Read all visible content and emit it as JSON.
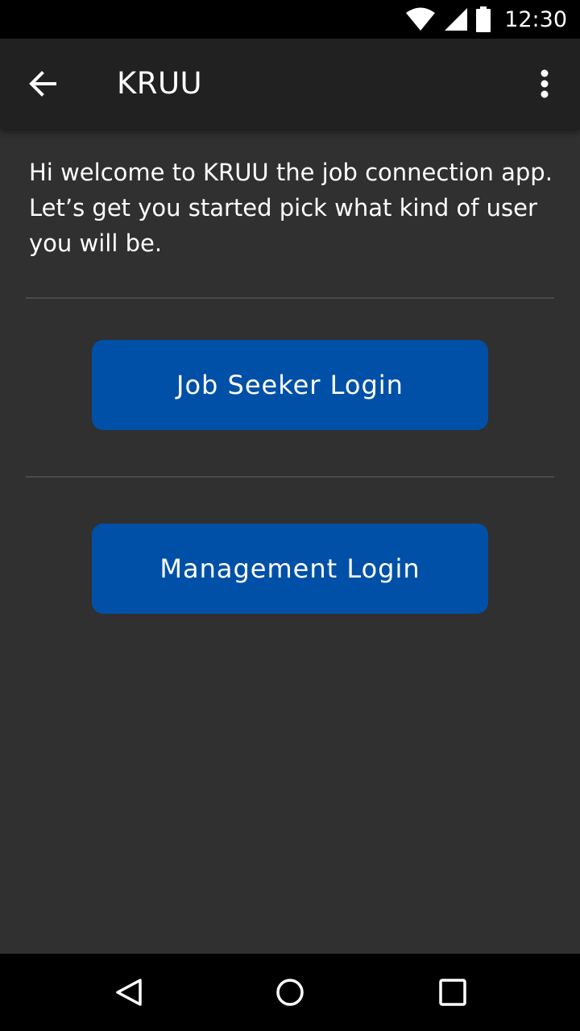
{
  "status_bar": {
    "time": "12:30",
    "icons": [
      "wifi-icon",
      "cell-signal-icon",
      "battery-icon"
    ]
  },
  "app_bar": {
    "title": "KRUU",
    "back_icon": "arrow-back-icon",
    "menu_icon": "more-vert-icon"
  },
  "main": {
    "welcome_text": "Hi welcome to KRUU the job connection app. Let’s get you started pick what kind of user you will be.",
    "job_seeker_label": "Job Seeker Login",
    "management_label": "Management Login"
  },
  "nav_bar": {
    "icons": [
      "back-triangle-icon",
      "home-circle-icon",
      "recents-square-icon"
    ]
  },
  "colors": {
    "background": "#303030",
    "app_bar": "#212121",
    "button": "#0050a8",
    "text": "#ffffff"
  }
}
